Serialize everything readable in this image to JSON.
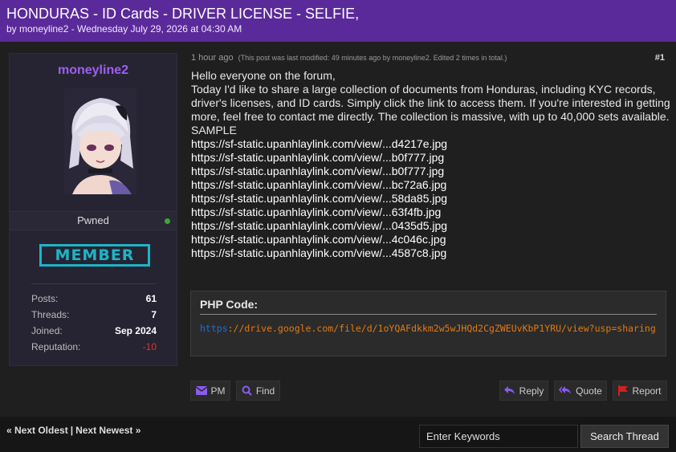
{
  "thread": {
    "title": "HONDURAS - ID Cards - DRIVER LICENSE - SELFIE,",
    "byline": "by moneyline2 - Wednesday July 29, 2026 at 04:30 AM"
  },
  "user": {
    "username": "moneyline2",
    "usertitle": "Pwned",
    "rank": "MEMBER",
    "stats": [
      {
        "label": "Posts:",
        "value": "61"
      },
      {
        "label": "Threads:",
        "value": "7"
      },
      {
        "label": "Joined:",
        "value": "Sep 2024"
      },
      {
        "label": "Reputation:",
        "value": "-10"
      }
    ]
  },
  "post": {
    "time": "1 hour ago",
    "edited_note": "(This post was last modified: 49 minutes ago by moneyline2. Edited 2 times in total.)",
    "number": "#1",
    "greeting": "Hello everyone on the forum,",
    "paragraph": "Today I'd like to share a large collection of documents from Honduras, including KYC records, driver's licenses, and ID cards. Simply click the link to access them. If you're interested in getting more, feel free to contact me directly. The collection is massive, with up to 40,000 sets available.",
    "sample_label": "SAMPLE",
    "links": [
      "https://sf-static.upanhlaylink.com/view/...d4217e.jpg",
      "https://sf-static.upanhlaylink.com/view/...b0f777.jpg",
      "https://sf-static.upanhlaylink.com/view/...b0f777.jpg",
      "https://sf-static.upanhlaylink.com/view/...bc72a6.jpg",
      "https://sf-static.upanhlaylink.com/view/...58da85.jpg",
      "https://sf-static.upanhlaylink.com/view/...63f4fb.jpg",
      "https://sf-static.upanhlaylink.com/view/...0435d5.jpg",
      "https://sf-static.upanhlaylink.com/view/...4c046c.jpg",
      "https://sf-static.upanhlaylink.com/view/...4587c8.jpg"
    ],
    "code": {
      "title": "PHP Code:",
      "protocol": "https",
      "rest": "://drive.google.com/file/d/1oYQAFdkkm2w5wJHQd2CgZWEUvKbP1YRU/view?usp=sharing"
    }
  },
  "actions": {
    "pm": "PM",
    "find": "Find",
    "reply": "Reply",
    "quote": "Quote",
    "report": "Report"
  },
  "footer": {
    "next_oldest": "« Next Oldest",
    "separator": "|",
    "next_newest": "Next Newest »",
    "search_placeholder": "Enter Keywords",
    "search_button": "Search Thread"
  },
  "colors": {
    "header_bg": "#5b2a9a",
    "username": "#9d5ff0",
    "rank_badge": "#1db5c6",
    "reputation_negative": "#e0342b",
    "online": "#3aa835",
    "icon_purple": "#8a5cf0",
    "report_red": "#d02020"
  }
}
